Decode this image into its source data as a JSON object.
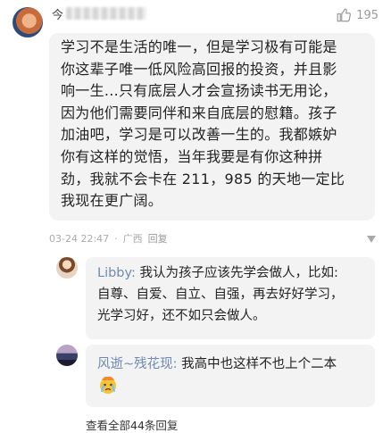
{
  "main_comment": {
    "username": "今",
    "likes": "195",
    "text": "学习不是生活的唯一，但是学习极有可能是\n你这辈子唯一低风险高回报的投资，并且影\n响一生...只有底层人才会宣扬读书无用论，\n因为他们需要同伴和来自底层的慰籍。孩子\n加油吧，学习是可以改善一生的。我都嫉妒\n你有这样的觉悟，当年我要是有你这种拼\n劲，我就不会卡在 211，985 的天地一定比\n我现在更广阔。",
    "time": "03-24 22:47",
    "location": "广西",
    "reply_label": "回复"
  },
  "replies": [
    {
      "name": "Libby:",
      "text": "我认为孩子应该先学会做人，比如:\n自尊、自爱、自立、自强，再去好好学习，\n光学习好，还不如只会做人。"
    },
    {
      "name": "风逝~残花现:",
      "text": "我高中也这样不也上个二本"
    }
  ],
  "view_all": "查看全部44条回复",
  "icons": {
    "like": "thumbs-up-icon",
    "more": "triangle-down-icon",
    "emoji": "crying-emoji-icon"
  }
}
